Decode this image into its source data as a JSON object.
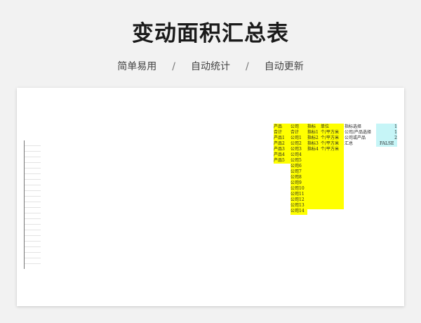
{
  "header": {
    "title": "变动面积汇总表",
    "tags": [
      "简单易用",
      "自动统计",
      "自动更新"
    ],
    "separator": "/"
  },
  "sheet": {
    "col_product": [
      "产品",
      "合计",
      "产品1",
      "产品2",
      "产品3",
      "产品4",
      "产品5"
    ],
    "col_company": [
      "公司",
      "合计",
      "公司1",
      "公司2",
      "公司3",
      "公司4",
      "公司5",
      "公司6",
      "公司7",
      "公司8",
      "公司9",
      "公司10",
      "公司11",
      "公司12",
      "公司13",
      "公司14"
    ],
    "col_indicator": [
      "指标",
      "指标1",
      "指标2",
      "指标3",
      "指标4"
    ],
    "col_unit": [
      "单位",
      "个/平方米",
      "个/平方米",
      "个/平方米",
      "个/平方米"
    ],
    "settings": [
      {
        "label": "指标选择",
        "value": "1"
      },
      {
        "label": "公司/产品选择",
        "value": "1"
      },
      {
        "label": "公司或产品",
        "value": "2"
      },
      {
        "label": "汇总",
        "value": "FALSE"
      }
    ]
  },
  "colors": {
    "highlight_yellow": "#ffff00",
    "highlight_cyan": "#c6f5f7"
  }
}
